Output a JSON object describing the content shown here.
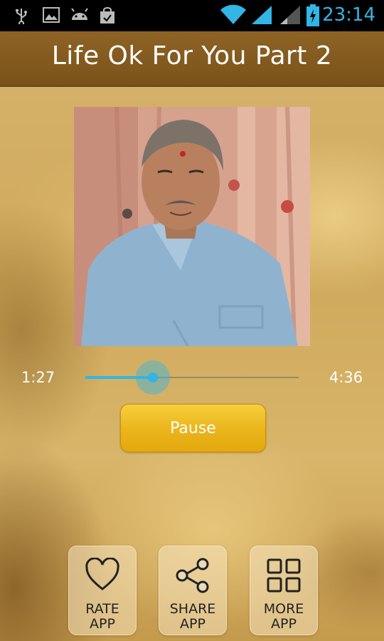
{
  "status_bar": {
    "time": "23:14",
    "icons": [
      "usb-icon",
      "gallery-icon",
      "android-icon",
      "shopping-bag-icon",
      "wifi-icon",
      "signal-icon",
      "signal-weak-icon",
      "battery-icon"
    ]
  },
  "header": {
    "title": "Life Ok For You Part 2"
  },
  "player": {
    "current_time": "1:27",
    "total_time": "4:36",
    "progress": 0.315,
    "pause_label": "Pause"
  },
  "bottom_actions": [
    {
      "line1": "RATE",
      "line2": "APP",
      "icon": "heart-icon"
    },
    {
      "line1": "SHARE",
      "line2": "APP",
      "icon": "share-icon"
    },
    {
      "line1": "MORE",
      "line2": "APP",
      "icon": "grid-icon"
    }
  ],
  "colors": {
    "accent": "#33b5e5",
    "title_bar": "#7f561c",
    "pause_button": "#eab41a"
  }
}
